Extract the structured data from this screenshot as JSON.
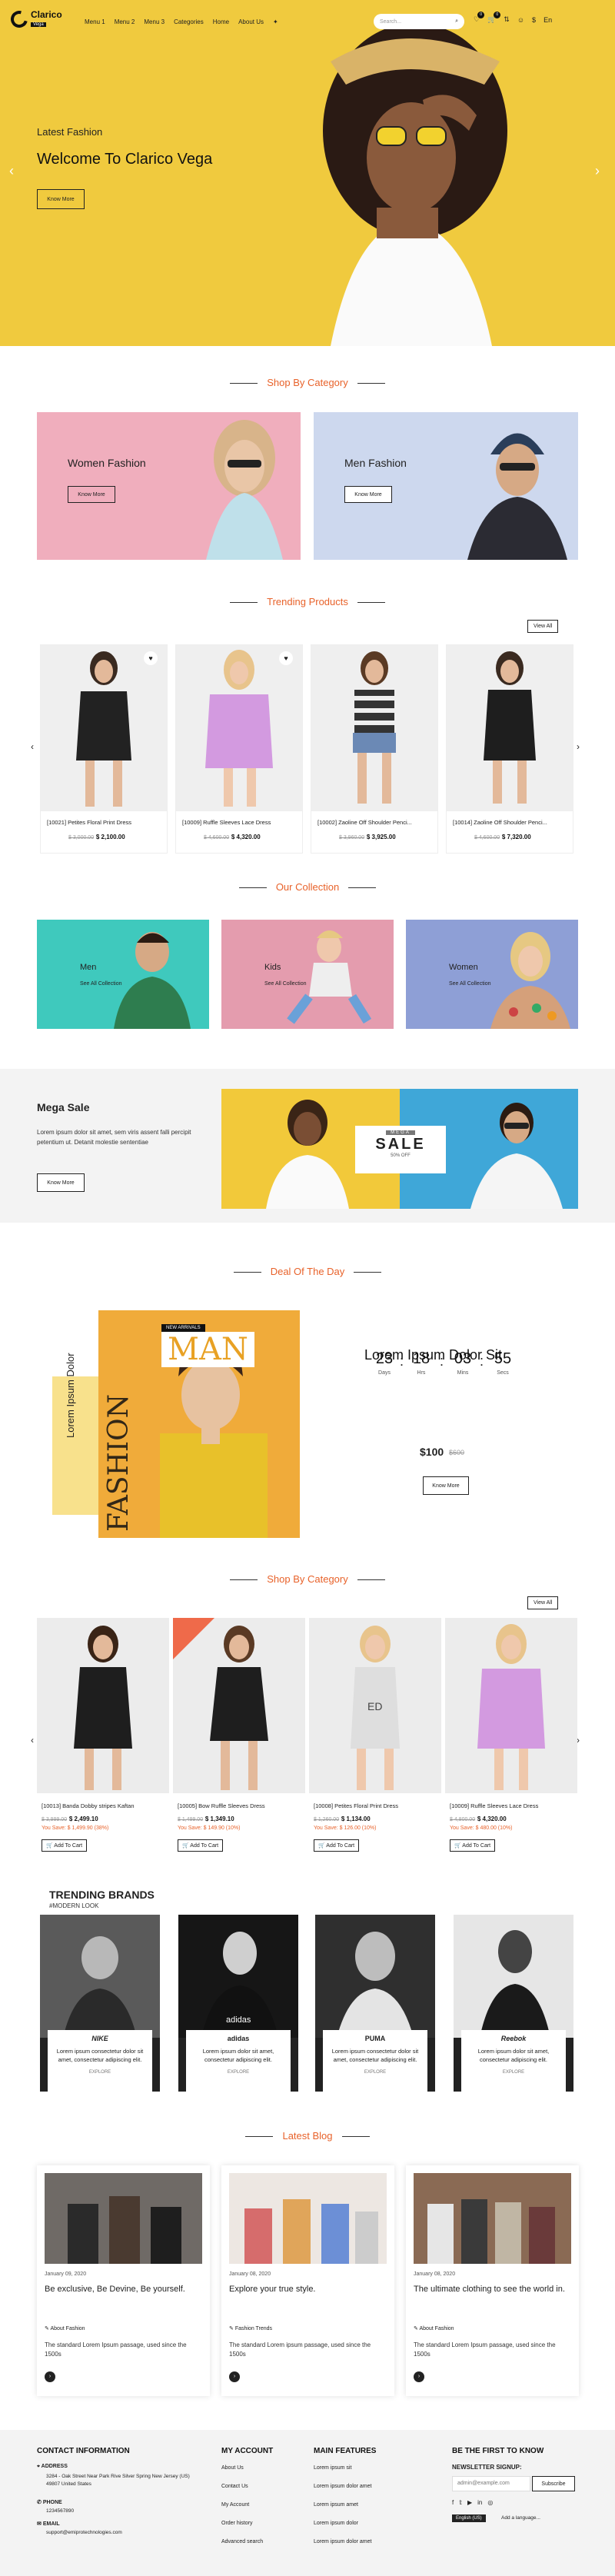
{
  "header": {
    "logo": "Clarico",
    "logo_sub": "Vega",
    "nav": [
      "Menu 1",
      "Menu 2",
      "Menu 3",
      "Categories",
      "Home",
      "About Us"
    ],
    "search_placeholder": "Search...",
    "cart_count": "0",
    "wishlist_count": "0",
    "currency": "$",
    "language": "En"
  },
  "hero": {
    "subtitle": "Latest Fashion",
    "title": "Welcome To Clarico Vega",
    "button": "Know More"
  },
  "shop_by_category_1": {
    "title": "Shop By Category",
    "tiles": [
      {
        "label": "Women Fashion",
        "button": "Know More"
      },
      {
        "label": "Men Fashion",
        "button": "Know More"
      }
    ]
  },
  "trending": {
    "title": "Trending Products",
    "view_all": "View All",
    "products": [
      {
        "name": "[10021] Petites Floral Print Dress",
        "old": "$ 3,000.00",
        "new": "$ 2,100.00"
      },
      {
        "name": "[10009] Ruffle Sleeves Lace Dress",
        "old": "$ 4,600.00",
        "new": "$ 4,320.00"
      },
      {
        "name": "[10002] Zaoline Off Shoulder Penci...",
        "old": "$ 3,960.00",
        "new": "$ 3,925.00"
      },
      {
        "name": "[10014] Zaoline Off Shoulder Penci...",
        "old": "$ 4,600.00",
        "new": "$ 7,320.00"
      }
    ]
  },
  "collection": {
    "title": "Our Collection",
    "tiles": [
      {
        "label": "Men",
        "link": "See All Collection",
        "color": "#3fc9bd"
      },
      {
        "label": "Kids",
        "link": "See All Collection",
        "color": "#e49cae"
      },
      {
        "label": "Women",
        "link": "See All Collection",
        "color": "#8e9fd6"
      }
    ]
  },
  "mega_sale": {
    "title": "Mega Sale",
    "text": "Lorem ipsum dolor sit amet, sem viris assent falli percipit petentium ut. Detanit molestie sententiae",
    "button": "Know More",
    "sale_top": "MEGA",
    "sale_word": "SALE",
    "sale_sub": "50% OFF"
  },
  "deal": {
    "title": "Deal Of The Day",
    "vertical_text": "Lorem Ipsum Dolor",
    "fashion_word": "FASHION",
    "new_arrivals": "NEW ARRIVALS",
    "man_word": "MAN",
    "heading": "Lorem Ipsum Dolor Sit",
    "countdown": [
      {
        "value": "23",
        "unit": "Days"
      },
      {
        "value": "18",
        "unit": "Hrs"
      },
      {
        "value": "03",
        "unit": "Mins"
      },
      {
        "value": "55",
        "unit": "Secs"
      }
    ],
    "price": "$100",
    "old_price": "$600",
    "button": "Know More"
  },
  "shop_by_category_2": {
    "title": "Shop By Category",
    "view_all": "View All",
    "products": [
      {
        "name": "[10013] Banda Dobby stripes Kaftan",
        "old": "$ 3,999.00",
        "new": "$ 2,499.10",
        "save": "You Save: $ 1,499.90 (38%)",
        "button": "Add To Cart"
      },
      {
        "name": "[10005] Bow Ruffle Sleeves Dress",
        "old": "$ 1,499.00",
        "new": "$ 1,349.10",
        "save": "You Save: $ 149.90 (10%)",
        "button": "Add To Cart"
      },
      {
        "name": "[10008] Petites Floral Print Dress",
        "old": "$ 1,260.00",
        "new": "$ 1,134.00",
        "save": "You Save: $ 126.00 (10%)",
        "button": "Add To Cart"
      },
      {
        "name": "[10009] Ruffle Sleeves Lace Dress",
        "old": "$ 4,800.00",
        "new": "$ 4,320.00",
        "save": "You Save: $ 480.00 (10%)",
        "button": "Add To Cart"
      }
    ]
  },
  "brands": {
    "title": "TRENDING BRANDS",
    "subtitle": "#MODERN LOOK",
    "items": [
      {
        "text": "Lorem ipsum consectetur dolor sit amet, consectetur adipiscing elit.",
        "tag": "EXPLORE",
        "logo": "NIKE"
      },
      {
        "text": "Lorem ipsum dolor sit amet, consectetur adipiscing elit.",
        "tag": "EXPLORE",
        "logo": "adidas"
      },
      {
        "text": "Lorem ipsum consectetur dolor sit amet, consectetur adipiscing elit.",
        "tag": "EXPLORE",
        "logo": "PUMA"
      },
      {
        "text": "Lorem ipsum dolor sit amet, consectetur adipiscing elit.",
        "tag": "EXPLORE",
        "logo": "Reebok"
      }
    ]
  },
  "blog": {
    "title": "Latest Blog",
    "posts": [
      {
        "date": "January 09, 2020",
        "title": "Be exclusive, Be Devine, Be yourself.",
        "category": "About Fashion",
        "text": "The standard Lorem Ipsum passage, used since the 1500s"
      },
      {
        "date": "January 08, 2020",
        "title": "Explore your true style.",
        "category": "Fashion Trends",
        "text": "The standard Lorem ipsum passage, used since the 1500s"
      },
      {
        "date": "January 08, 2020",
        "title": "The ultimate clothing to see the world in.",
        "category": "About Fashion",
        "text": "The standard Lorem Ipsum passage, used since the 1500s"
      }
    ]
  },
  "footer": {
    "contact_title": "CONTACT INFORMATION",
    "address_label": "ADDRESS",
    "address": "3284 - Oak Street Near Park Rive Silver Spring New Jersey (US) 49807 United States",
    "phone_label": "PHONE",
    "phone": "1234567890",
    "email_label": "EMAIL",
    "email": "support@emiprotechnologies.com",
    "account_title": "MY ACCOUNT",
    "account_links": [
      "About Us",
      "Contact Us",
      "My Account",
      "Order history",
      "Advanced search"
    ],
    "features_title": "MAIN FEATURES",
    "features_links": [
      "Lorem ipsum sit",
      "Lorem ipsum dolor amet",
      "Lorem ipsum amet",
      "Lorem ipsum dolor",
      "Lorem ipsum dolor amet"
    ],
    "newsletter_title": "BE THE FIRST TO KNOW",
    "newsletter_label": "NEWSLETTER SIGNUP:",
    "newsletter_placeholder": "admin@example.com",
    "subscribe": "Subscribe",
    "lang": "English (US)",
    "add_language": "Add a language..."
  }
}
